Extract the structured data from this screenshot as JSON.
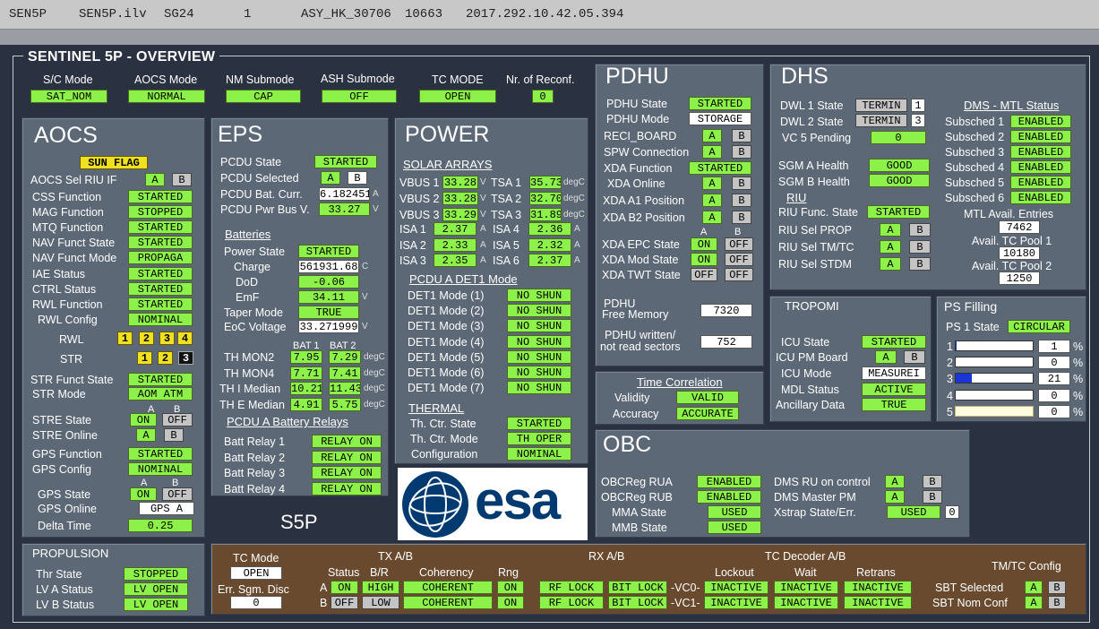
{
  "titlebar": [
    "SEN5P",
    "SEN5P.ilv",
    "SG24",
    "1",
    "ASY_HK_30706",
    "10663",
    "2017.292.10.42.05.394"
  ],
  "main_title": "SENTINEL 5P - OVERVIEW",
  "header": {
    "labels": [
      "S/C Mode",
      "AOCS Mode",
      "NM Submode",
      "ASH Submode",
      "TC MODE",
      "Nr. of Reconf."
    ],
    "values": [
      "SAT_NOM",
      "NORMAL",
      "CAP",
      "OFF",
      "OPEN",
      "0"
    ]
  },
  "aocs": {
    "title": "AOCS",
    "sunflag": "SUN FLAG",
    "riu_label": "AOCS Sel RIU IF",
    "riu_a": "A",
    "riu_b": "B",
    "rows": [
      [
        "CSS Function",
        "STARTED"
      ],
      [
        "MAG Function",
        "STOPPED"
      ],
      [
        "MTQ Function",
        "STARTED"
      ],
      [
        "NAV Funct State",
        "STARTED"
      ],
      [
        "NAV Funct Mode",
        "PROPAGA"
      ],
      [
        "IAE Status",
        "STARTED"
      ],
      [
        "CTRL Status",
        "STARTED"
      ],
      [
        "RWL Function",
        "STARTED"
      ],
      [
        "RWL Config",
        "NOMINAL"
      ]
    ],
    "rwl_label": "RWL",
    "rwl": [
      "1",
      "2",
      "3",
      "4"
    ],
    "str_label": "STR",
    "str": [
      "1",
      "2",
      "3"
    ],
    "rows2": [
      [
        "STR Funct State",
        "STARTED"
      ],
      [
        "STR Mode",
        "AOM ATM"
      ]
    ],
    "ab_a": "A",
    "ab_b": "B",
    "stre_state": "STRE State",
    "stre_state_a": "ON",
    "stre_state_b": "OFF",
    "stre_online": "STRE Online",
    "stre_online_a": "A",
    "stre_online_b": "B",
    "rows3": [
      [
        "GPS Function",
        "STARTED"
      ],
      [
        "GPS Config",
        "NOMINAL"
      ]
    ],
    "gps_state": "GPS State",
    "gps_state_a": "ON",
    "gps_state_b": "OFF",
    "gps_online": "GPS Online",
    "gps_online_v": "GPS A",
    "delta": "Delta Time",
    "delta_v": "0.25"
  },
  "propulsion": {
    "title": "PROPULSION",
    "rows": [
      [
        "Thr State",
        "STOPPED"
      ],
      [
        "LV A Status",
        "LV OPEN"
      ],
      [
        "LV B Status",
        "LV OPEN"
      ]
    ]
  },
  "eps": {
    "title": "EPS",
    "pcdu_state": "PCDU State",
    "pcdu_state_v": "STARTED",
    "pcdu_sel": "PCDU Selected",
    "pcdu_sel_a": "A",
    "pcdu_sel_b": "B",
    "pcdu_curr": "PCDU Bat. Curr.",
    "pcdu_curr_v": "6.182451",
    "pcdu_curr_u": "A",
    "pcdu_bus": "PCDU Pwr Bus V.",
    "pcdu_bus_v": "33.27",
    "pcdu_bus_u": "V",
    "batteries": "Batteries",
    "power_state": "Power State",
    "power_state_v": "STARTED",
    "charge": "Charge",
    "charge_v": "561931.68",
    "charge_u": "C",
    "dod": "DoD",
    "dod_v": "-0.06",
    "emf": "EmF",
    "emf_v": "34.11",
    "emf_u": "V",
    "taper": "Taper Mode",
    "taper_v": "TRUE",
    "eoc": "EoC Voltage",
    "eoc_v": "33.271999",
    "eoc_u": "V",
    "bat1": "BAT 1",
    "bat2": "BAT 2",
    "th": [
      [
        "TH MON2",
        "7.95",
        "7.29"
      ],
      [
        "TH MON4",
        "7.71",
        "7.41"
      ],
      [
        "TH I Median",
        "10.21",
        "11.43"
      ],
      [
        "TH E Median",
        "4.91",
        "5.75"
      ]
    ],
    "th_u": "degC",
    "relays_title": "PCDU A Battery Relays",
    "relays": [
      [
        "Batt Relay 1",
        "RELAY ON"
      ],
      [
        "Batt Relay 2",
        "RELAY ON"
      ],
      [
        "Batt Relay 3",
        "RELAY ON"
      ],
      [
        "Batt Relay 4",
        "RELAY ON"
      ]
    ]
  },
  "s5p": "S5P",
  "power": {
    "title": "POWER",
    "solar": "SOLAR ARRAYS",
    "vbus": [
      [
        "VBUS 1",
        "33.28"
      ],
      [
        "VBUS 2",
        "33.28"
      ],
      [
        "VBUS 3",
        "33.29"
      ]
    ],
    "vbus_u": "V",
    "tsa": [
      [
        "TSA 1",
        "35.73"
      ],
      [
        "TSA 2",
        "32.70"
      ],
      [
        "TSA 3",
        "31.89"
      ]
    ],
    "tsa_u": "degC",
    "isa_l": [
      [
        "ISA 1",
        "2.37"
      ],
      [
        "ISA 2",
        "2.33"
      ],
      [
        "ISA 3",
        "2.35"
      ]
    ],
    "isa_r": [
      [
        "ISA 4",
        "2.36"
      ],
      [
        "ISA 5",
        "2.32"
      ],
      [
        "ISA 6",
        "2.37"
      ]
    ],
    "isa_u": "A",
    "det_title": "PCDU A DET1 Mode",
    "det": [
      [
        "DET1 Mode (1)",
        "NO SHUN"
      ],
      [
        "DET1 Mode (2)",
        "NO SHUN"
      ],
      [
        "DET1 Mode (3)",
        "NO SHUN"
      ],
      [
        "DET1 Mode (4)",
        "NO SHUN"
      ],
      [
        "DET1 Mode (5)",
        "NO SHUN"
      ],
      [
        "DET1 Mode (6)",
        "NO SHUN"
      ],
      [
        "DET1 Mode (7)",
        "NO SHUN"
      ]
    ],
    "thermal": "THERMAL",
    "therm": [
      [
        "Th. Ctr. State",
        "STARTED"
      ],
      [
        "Th. Ctr. Mode",
        "TH OPER"
      ],
      [
        "Configuration",
        "NOMINAL"
      ]
    ]
  },
  "esa": "esa",
  "pdhu": {
    "title": "PDHU",
    "state": "PDHU State",
    "state_v": "STARTED",
    "mode": "PDHU Mode",
    "mode_v": "STORAGE",
    "ab": [
      [
        "RECI_BOARD",
        "A",
        "B"
      ],
      [
        "SPW Connection",
        "A",
        "B"
      ]
    ],
    "xda_func": "XDA Function",
    "xda_func_v": "STARTED",
    "ab2": [
      [
        "XDA Online",
        "A",
        "B"
      ],
      [
        "XDA A1 Position",
        "A",
        "B"
      ],
      [
        "XDA B2 Position",
        "A",
        "B"
      ]
    ],
    "col_a": "A",
    "col_b": "B",
    "onoff": [
      [
        "XDA EPC State",
        "ON",
        "OFF"
      ],
      [
        "XDA Mod State",
        "ON",
        "OFF"
      ],
      [
        "XDA TWT State",
        "OFF",
        "OFF"
      ]
    ],
    "free1": "PDHU",
    "free2": "Free Memory",
    "free_v": "7320",
    "written1": "PDHU written/",
    "written2": "not read sectors",
    "written_v": "752"
  },
  "timecorr": {
    "title": "Time Correlation",
    "validity": "Validity",
    "validity_v": "VALID",
    "accuracy": "Accuracy",
    "accuracy_v": "ACCURATE"
  },
  "dhs": {
    "title": "DHS",
    "dwl1": "DWL 1 State",
    "dwl1_v": "TERMIN",
    "dwl1_n": "1",
    "dwl2": "DWL 2 State",
    "dwl2_v": "TERMIN",
    "dwl2_n": "3",
    "vc5": "VC 5 Pending",
    "vc5_v": "0",
    "sgma": "SGM A Health",
    "sgma_v": "GOOD",
    "sgmb": "SGM B Health",
    "sgmb_v": "GOOD",
    "riu": "RIU",
    "riu_func": "RIU Func. State",
    "riu_func_v": "STARTED",
    "riu_ab": [
      [
        "RIU Sel PROP",
        "A",
        "B"
      ],
      [
        "RIU Sel TM/TC",
        "A",
        "B"
      ],
      [
        "RIU Sel STDM",
        "A",
        "B"
      ]
    ],
    "mtl_title": "DMS - MTL Status",
    "subs": [
      [
        "Subsched 1",
        "ENABLED"
      ],
      [
        "Subsched 2",
        "ENABLED"
      ],
      [
        "Subsched 3",
        "ENABLED"
      ],
      [
        "Subsched 4",
        "ENABLED"
      ],
      [
        "Subsched 5",
        "ENABLED"
      ],
      [
        "Subsched 6",
        "ENABLED"
      ]
    ],
    "mtl_avail": "MTL Avail. Entries",
    "mtl_avail_v": "7462",
    "tc1": "Avail. TC Pool 1",
    "tc1_v": "10180",
    "tc2": "Avail. TC Pool 2",
    "tc2_v": "1250"
  },
  "tropomi": {
    "title": "TROPOMI",
    "icu_state": "ICU State",
    "icu_state_v": "STARTED",
    "icu_pm": "ICU PM Board",
    "icu_pm_a": "A",
    "icu_pm_b": "B",
    "icu_mode": "ICU Mode",
    "icu_mode_v": "MEASUREI",
    "mdl": "MDL Status",
    "mdl_v": "ACTIVE",
    "anc": "Ancillary Data",
    "anc_v": "TRUE"
  },
  "ps": {
    "title": "PS Filling",
    "state": "PS 1 State",
    "state_v": "CIRCULAR",
    "rows": [
      {
        "n": "1",
        "v": "1",
        "f": 0.01
      },
      {
        "n": "2",
        "v": "0",
        "f": 0
      },
      {
        "n": "3",
        "v": "21",
        "f": 0.21
      },
      {
        "n": "4",
        "v": "0",
        "f": 0
      },
      {
        "n": "5",
        "v": "0",
        "f": 0
      }
    ],
    "unit": "%"
  },
  "obc": {
    "title": "OBC",
    "rua": "OBCReg RUA",
    "rua_v": "ENABLED",
    "rub": "OBCReg RUB",
    "rub_v": "ENABLED",
    "mma": "MMA State",
    "mma_v": "USED",
    "mmb": "MMB State",
    "mmb_v": "USED",
    "dms_ru": "DMS RU on control",
    "dms_ru_a": "A",
    "dms_ru_b": "B",
    "dms_pm": "DMS Master PM",
    "dms_pm_a": "A",
    "dms_pm_b": "B",
    "xstrap": "Xstrap State/Err.",
    "xstrap_v": "USED",
    "xstrap_n": "0"
  },
  "tc": {
    "tc_mode": "TC Mode",
    "tc_mode_v": "OPEN",
    "err": "Err. Sgm. Disc",
    "err_v": "0",
    "txab": "TX A/B",
    "status": "Status",
    "br": "B/R",
    "coherency": "Coherency",
    "rng": "Rng",
    "rowA": "A",
    "rowB": "B",
    "tx": [
      [
        "ON",
        "HIGH",
        "COHERENT",
        "ON"
      ],
      [
        "OFF",
        "LOW",
        "COHERENT",
        "ON"
      ]
    ],
    "rxab": "RX A/B",
    "rx": [
      [
        "RF LOCK",
        "BIT LOCK",
        "-VC0-"
      ],
      [
        "RF LOCK",
        "BIT LOCK",
        "-VC1-"
      ]
    ],
    "tcdec": "TC Decoder A/B",
    "lockout": "Lockout",
    "wait": "Wait",
    "retrans": "Retrans",
    "dec": [
      [
        "INACTIVE",
        "INACTIVE",
        "INACTIVE"
      ],
      [
        "INACTIVE",
        "INACTIVE",
        "INACTIVE"
      ]
    ],
    "tmtc": "TM/TC Config",
    "sbt_sel": "SBT Selected",
    "sbt_sel_a": "A",
    "sbt_sel_b": "B",
    "sbt_nom": "SBT Nom Conf",
    "sbt_nom_a": "A",
    "sbt_nom_b": "B"
  },
  "colors": {
    "green": "#8cf24a",
    "white": "#ffffff",
    "gray": "#c4c4c4",
    "yellow": "#f0e020",
    "panel": "#5d6877",
    "bg": "#2a3140",
    "brown": "#6a4a2e"
  }
}
